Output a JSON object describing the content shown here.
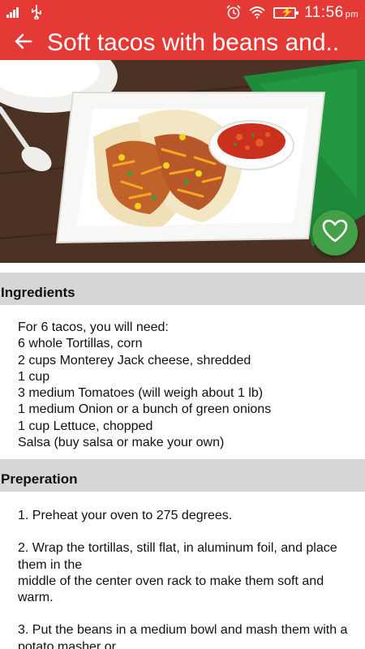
{
  "status_bar": {
    "time": "11:56",
    "ampm": "pm",
    "icons": [
      "signal-icon",
      "usb-icon",
      "alarm-icon",
      "wifi-icon",
      "battery-charging-icon"
    ]
  },
  "app_bar": {
    "title": "Soft tacos with beans and..",
    "back_icon": "arrow-left-icon"
  },
  "hero": {
    "alt": "Soft tacos on a white plate with salsa",
    "favorite_icon": "heart-outline-icon",
    "favorite_color": "#43a047"
  },
  "ingredients": {
    "header": "Ingredients",
    "lines": [
      "For 6 tacos, you will need:",
      "6 whole Tortillas, corn",
      "2 cups Monterey Jack cheese, shredded",
      "1 cup",
      "3 medium Tomatoes (will weigh about 1 lb)",
      "1 medium Onion or a bunch of green onions",
      "1 cup Lettuce, chopped",
      "Salsa (buy salsa or make your own)"
    ]
  },
  "preparation": {
    "header": "Preperation",
    "step1": "1. Preheat your oven to 275 degrees.",
    "step2a": "2. Wrap the tortillas, still flat, in aluminum foil, and place them in the",
    "step2b": "middle of the center oven rack to make them soft and warm.",
    "step3a": "3. Put the beans in a medium bowl and mash them with a potato masher or"
  },
  "colors": {
    "primary": "#e53935",
    "section_bg": "#d6d6d6",
    "accent_green": "#43a047"
  }
}
